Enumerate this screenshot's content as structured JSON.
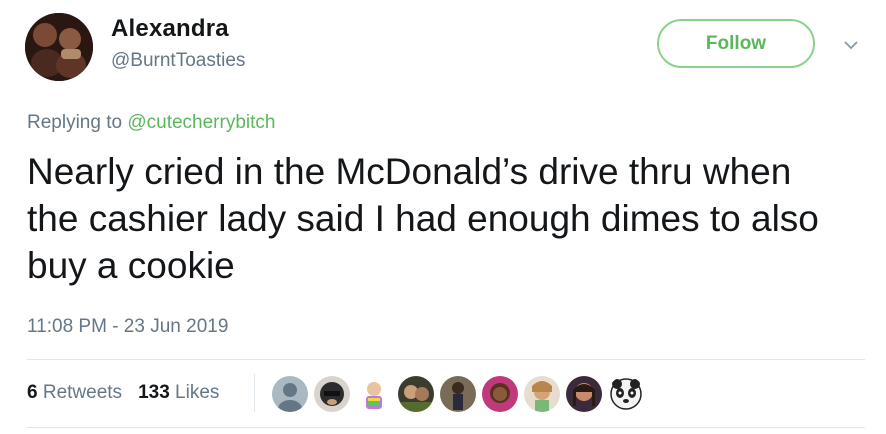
{
  "tweet": {
    "author_name": "Alexandra",
    "author_handle": "@BurntToasties",
    "follow_label": "Follow",
    "replying_prefix": "Replying to",
    "replying_to": "@cutecherrybitch",
    "text": "Nearly cried in the McDonald’s drive thru when the cashier lady said I had enough dimes to also buy a cookie",
    "timestamp": "11:08 PM - 23 Jun 2019",
    "retweets_count": "6",
    "retweets_label": "Retweets",
    "likes_count": "133",
    "likes_label": "Likes"
  },
  "icons": {
    "caret": "chevron-down-icon"
  },
  "colors": {
    "accent": "#5ab85a",
    "accent_border": "#8bd18b",
    "secondary_text": "#657786",
    "primary_text": "#14171a",
    "divider": "#e1e8ed"
  }
}
